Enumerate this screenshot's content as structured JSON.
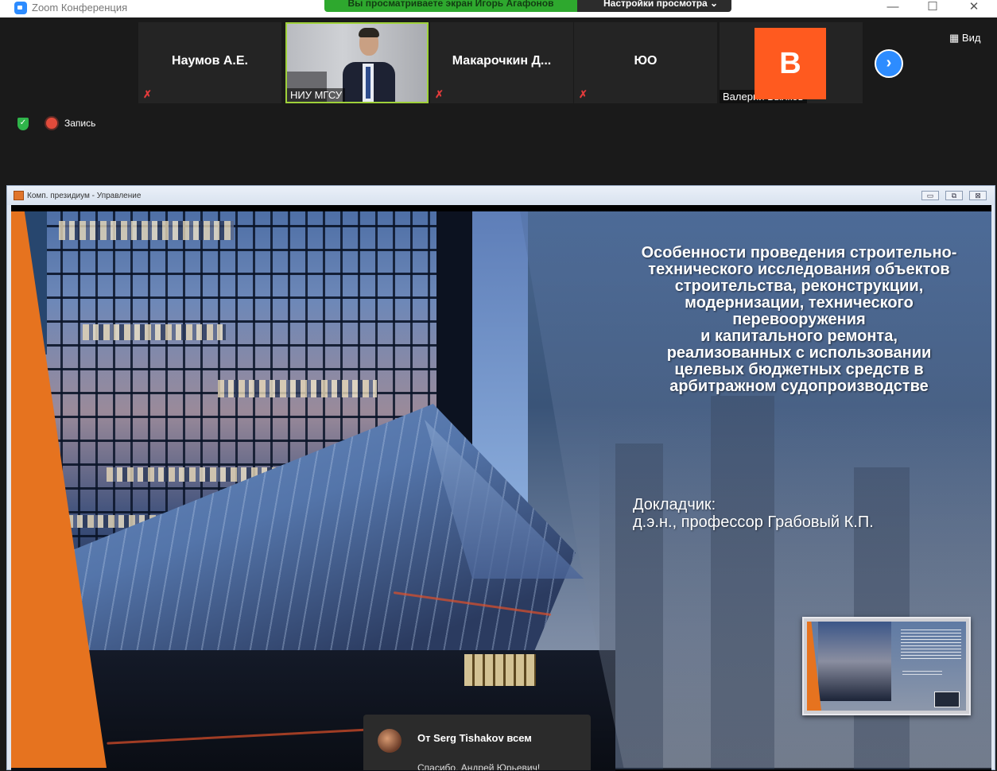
{
  "window": {
    "title": "Zoom Конференция",
    "minimize": "—",
    "maximize": "☐",
    "close": "✕"
  },
  "share_banner": {
    "text": "Вы просматриваете экран Игорь Агафонов",
    "view_options": "Настройки просмотра ⌄"
  },
  "participants": [
    {
      "name": "Наумов А.Е.",
      "muted": true
    },
    {
      "name": "НИУ МГСУ",
      "muted": false,
      "video": true
    },
    {
      "name": "Макарочкин   Д...",
      "muted": true
    },
    {
      "name": "ЮО",
      "muted": true
    },
    {
      "name": "Валерий Былков",
      "avatar_letter": "В",
      "avatar_color": "#ff5a1f"
    }
  ],
  "controls": {
    "view_label": "Вид",
    "next_icon": "chevron-right-icon",
    "recording_label": "Запись"
  },
  "shared_window": {
    "title": "Комп. президиум - Управление",
    "ctl_min": "▭",
    "ctl_max": "⧉",
    "ctl_close": "⊠"
  },
  "slide": {
    "title_lines": [
      "Особенности проведения строительно-",
      "технического исследования объектов",
      "строительства, реконструкции,",
      "модернизации, технического",
      "перевооружения",
      "и капитального ремонта,",
      "реализованных с использовании",
      "целевых бюджетных средств в",
      "арбитражном судопроизводстве"
    ],
    "speaker_label": "Докладчик:",
    "speaker_name": "д.э.н., профессор Грабовый К.П.",
    "accent_color": "#e6731f"
  },
  "chat": {
    "from": "От Serg Tishakov всем",
    "message": "Спасибо, Андрей Юрьевич!"
  }
}
